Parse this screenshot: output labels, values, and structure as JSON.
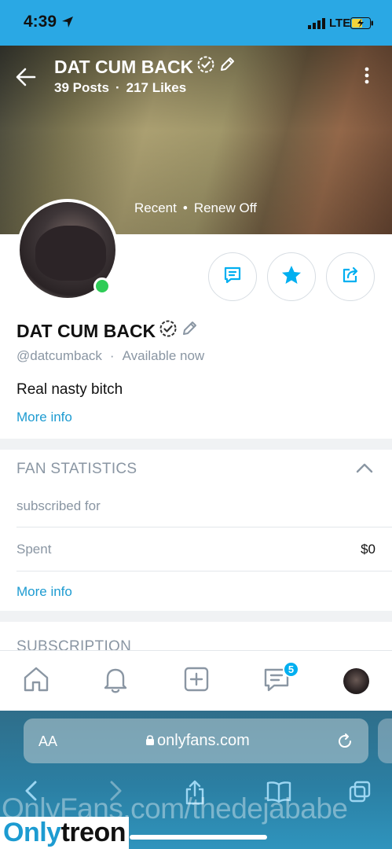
{
  "status_bar": {
    "time": "4:39",
    "network": "LTE"
  },
  "cover": {
    "title": "DAT CUM BACK",
    "posts": "39 Posts",
    "likes": "217 Likes",
    "recent": "Recent",
    "renew": "Renew Off"
  },
  "profile": {
    "name": "DAT CUM BACK",
    "handle": "@datcumback",
    "availability": "Available now",
    "bio": "Real nasty bitch",
    "more_info": "More info"
  },
  "fan_statistics": {
    "title": "FAN STATISTICS",
    "subscribed_label": "subscribed for",
    "spent_label": "Spent",
    "spent_value": "$0",
    "more_info": "More info"
  },
  "subscription": {
    "title": "SUBSCRIPTION"
  },
  "tab_bar": {
    "messages_badge": "5"
  },
  "browser": {
    "aa_label": "AA",
    "url": "onlyfans.com"
  },
  "watermark": {
    "text": "OnlyFans.com/thedejababe",
    "logo_part1": "Only",
    "logo_part2": "treon"
  },
  "colors": {
    "accent": "#00aff0",
    "status_bar": "#2aa8e4",
    "online": "#2ecc56"
  }
}
